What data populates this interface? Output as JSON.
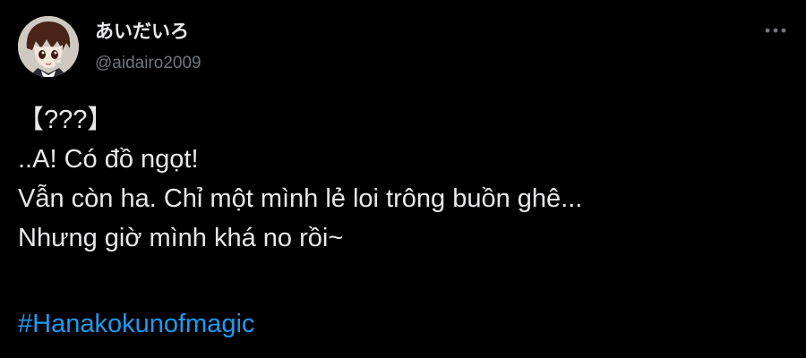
{
  "tweet": {
    "author": {
      "display_name": "あいだいろ",
      "handle": "@aidairo2009"
    },
    "more_icon": "more-horizontal-icon",
    "lines": [
      "【???】",
      "..A! Có đồ ngọt!",
      "Vẫn còn ha. Chỉ một mình lẻ loi trông buồn ghê...",
      "Nhưng giờ mình khá no rồi~"
    ],
    "hashtag": "#Hanakokunofmagic"
  },
  "colors": {
    "background": "#000000",
    "text": "#e7e9ea",
    "secondary_text": "#71767b",
    "link": "#1d9bf0"
  }
}
